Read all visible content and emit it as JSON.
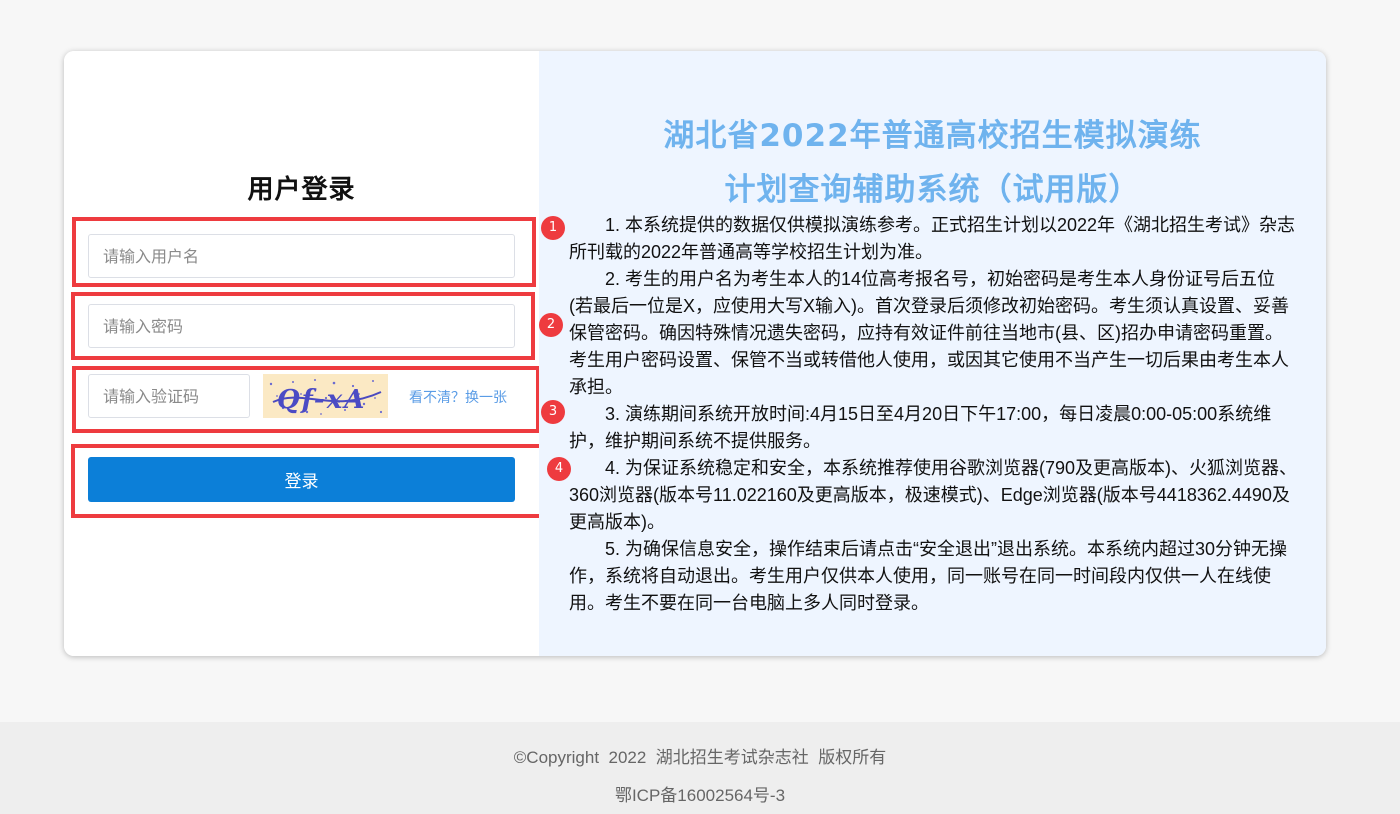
{
  "login": {
    "title": "用户登录",
    "username_placeholder": "请输入用户名",
    "password_placeholder": "请输入密码",
    "captcha_placeholder": "请输入验证码",
    "captcha_text": "Qf-xA",
    "captcha_refresh": "看不清？换一张",
    "submit_label": "登录"
  },
  "annotations": [
    "1",
    "2",
    "3",
    "4"
  ],
  "system": {
    "title_line1": "湖北省2022年普通高校招生模拟演练",
    "title_line2": "计划查询辅助系统（试用版）"
  },
  "notices": [
    "1. 本系统提供的数据仅供模拟演练参考。正式招生计划以2022年《湖北招生考试》杂志所刊载的2022年普通高等学校招生计划为准。",
    "2. 考生的用户名为考生本人的14位高考报名号，初始密码是考生本人身份证号后五位(若最后一位是X，应使用大写X输入)。首次登录后须修改初始密码。考生须认真设置、妥善保管密码。确因特殊情况遗失密码，应持有效证件前往当地市(县、区)招办申请密码重置。考生用户密码设置、保管不当或转借他人使用，或因其它使用不当产生一切后果由考生本人承担。",
    "3. 演练期间系统开放时间:4月15日至4月20日下午17:00，每日凌晨0:00-05:00系统维护，维护期间系统不提供服务。",
    "4. 为保证系统稳定和安全，本系统推荐使用谷歌浏览器(790及更高版本)、火狐浏览器、360浏览器(版本号11.022160及更高版本，极速模式)、Edge浏览器(版本号4418362.4490及更高版本)。",
    "5. 为确保信息安全，操作结束后请点击“安全退出”退出系统。本系统内超过30分钟无操作，系统将自动退出。考生用户仅供本人使用，同一账号在同一时间段内仅供一人在线使用。考生不要在同一台电脑上多人同时登录。"
  ],
  "footer": {
    "copyright": "©Copyright  2022  湖北招生考试杂志社  版权所有",
    "icp": "鄂ICP备16002564号-3"
  },
  "colors": {
    "accent": "#0c7fd8",
    "title": "#6fb3ee",
    "highlight": "#ee3b3f",
    "right_panel_bg": "#eef5ff"
  }
}
